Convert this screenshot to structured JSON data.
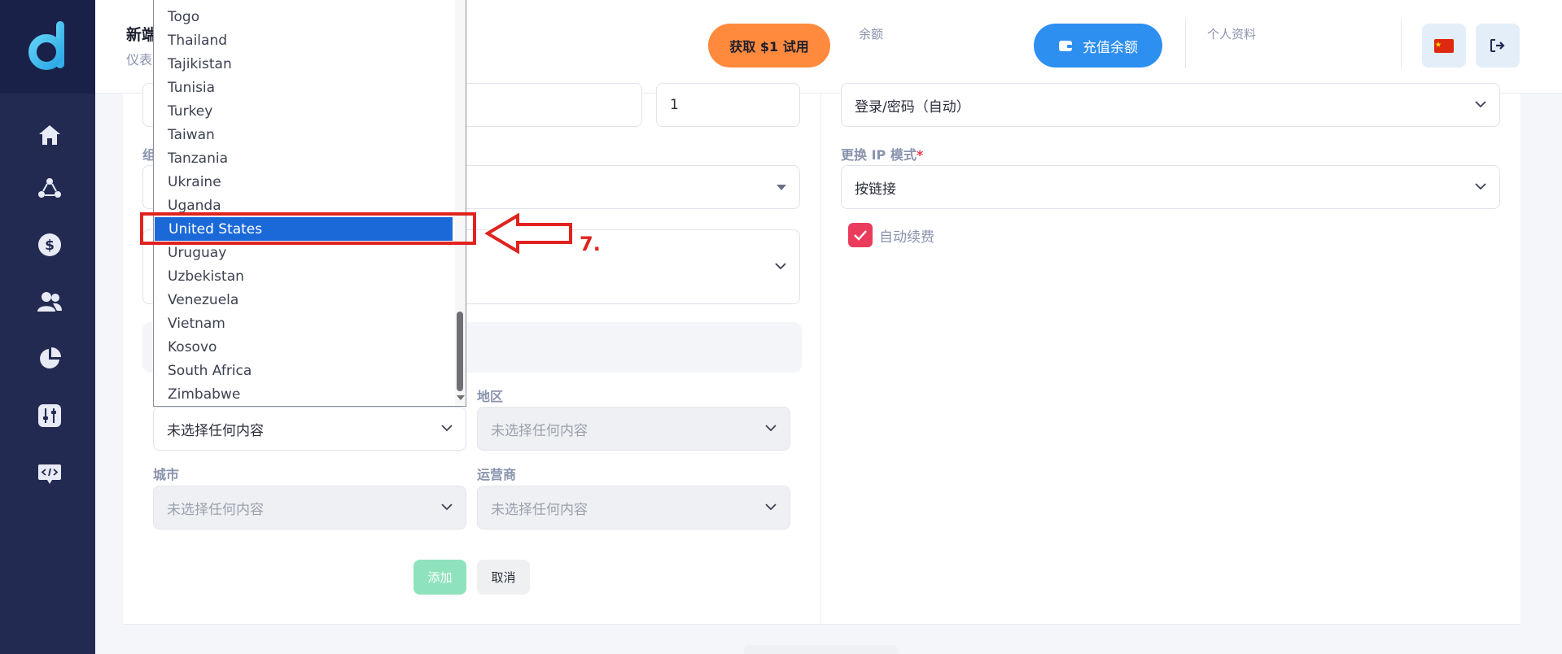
{
  "header": {
    "title": "新端",
    "breadcrumb": "仪表",
    "trial_button": "获取 $1 试用",
    "balance_link": "余额",
    "topup_button": "充值余额",
    "profile_link": "个人资料",
    "flag_icon": "china-flag-icon",
    "logout_icon": "logout-icon"
  },
  "sidebar": {
    "items": [
      {
        "icon": "home-icon"
      },
      {
        "icon": "network-icon"
      },
      {
        "icon": "dollar-icon"
      },
      {
        "icon": "users-icon"
      },
      {
        "icon": "pie-chart-icon"
      },
      {
        "icon": "settings-sliders-icon"
      },
      {
        "icon": "api-code-icon"
      }
    ]
  },
  "form_left": {
    "quantity_value": "1",
    "partial_label_1": "组",
    "country_value": "未选择任何内容",
    "region_label": "地区",
    "region_value": "未选择任何内容",
    "city_label": "城市",
    "city_value": "未选择任何内容",
    "carrier_label": "运营商",
    "carrier_value": "未选择任何内容",
    "add_button": "添加",
    "cancel_button": "取消"
  },
  "form_right": {
    "auth_value": "登录/密码（自动）",
    "ip_mode_label": "更换 IP 模式",
    "ip_mode_required": "*",
    "ip_mode_value": "按链接",
    "auto_renew_label": "自动续费",
    "auto_renew_checked": true
  },
  "country_dropdown": {
    "options": [
      "Togo",
      "Thailand",
      "Tajikistan",
      "Tunisia",
      "Turkey",
      "Taiwan",
      "Tanzania",
      "Ukraine",
      "Uganda",
      "United States",
      "Uruguay",
      "Uzbekistan",
      "Venezuela",
      "Vietnam",
      "Kosovo",
      "South Africa",
      "Zimbabwe"
    ],
    "selected": "United States"
  },
  "annotation": {
    "step_label": "7.",
    "color": "#e0231e"
  },
  "colors": {
    "sidebar": "#222a52",
    "accent_orange": "#ff8a3d",
    "accent_blue": "#2d8ff0",
    "checkbox": "#ea3b5c",
    "selected_option": "#1b69d8"
  }
}
